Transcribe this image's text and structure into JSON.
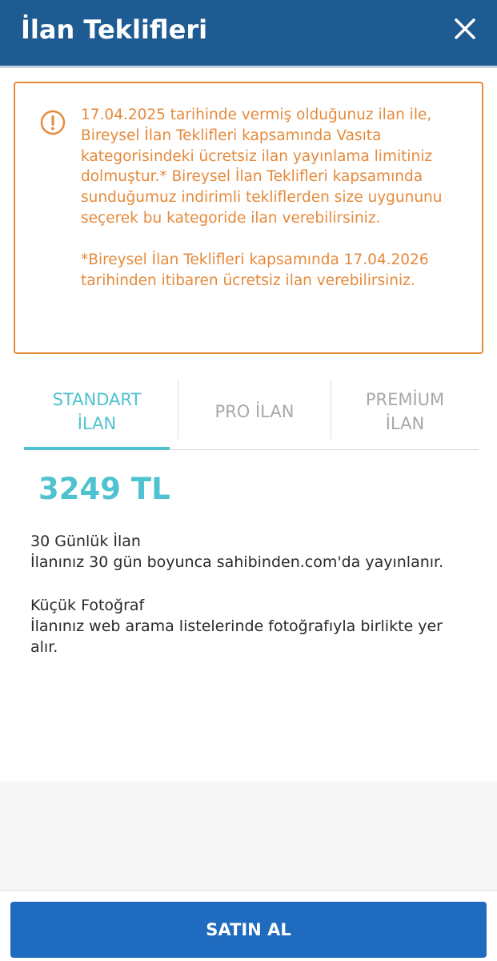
{
  "header": {
    "title": "İlan Teklifleri",
    "close_icon": "close-icon"
  },
  "warning": {
    "icon": "exclamation-circle-icon",
    "paragraph1": "17.04.2025 tarihinde vermiş olduğunuz ilan ile, Bireysel İlan Teklifleri kapsamında Vasıta kategorisindeki ücretsiz ilan yayınlama limitiniz dolmuştur.* Bireysel İlan Teklifleri kapsamında sunduğumuz indirimli tekliflerden size uygununu seçerek bu kategoride ilan verebilirsiniz.",
    "paragraph2": "*Bireysel İlan Teklifleri kapsamında 17.04.2026 tarihinden itibaren ücretsiz ilan verebilirsiniz.",
    "color": "#e58a3c"
  },
  "tabs": [
    {
      "label": "STANDART İLAN",
      "line1": "STANDART",
      "line2": "İLAN",
      "active": true
    },
    {
      "label": "PRO İLAN",
      "line1": "PRO İLAN",
      "line2": "",
      "active": false
    },
    {
      "label": "PREMİUM İLAN",
      "line1": "PREMİUM",
      "line2": "İLAN",
      "active": false
    }
  ],
  "price": "3249 TL",
  "features": [
    {
      "title": "30 Günlük İlan",
      "description": "İlanınız 30 gün boyunca sahibinden.com'da yayınlanır."
    },
    {
      "title": "Küçük Fotoğraf",
      "description": "İlanınız web arama listelerinde fotoğrafıyla birlikte yer alır."
    }
  ],
  "buy_button": "SATIN AL",
  "colors": {
    "header_bg": "#1f5b93",
    "accent_teal": "#4fc2cf",
    "button_blue": "#1f6bbf"
  }
}
